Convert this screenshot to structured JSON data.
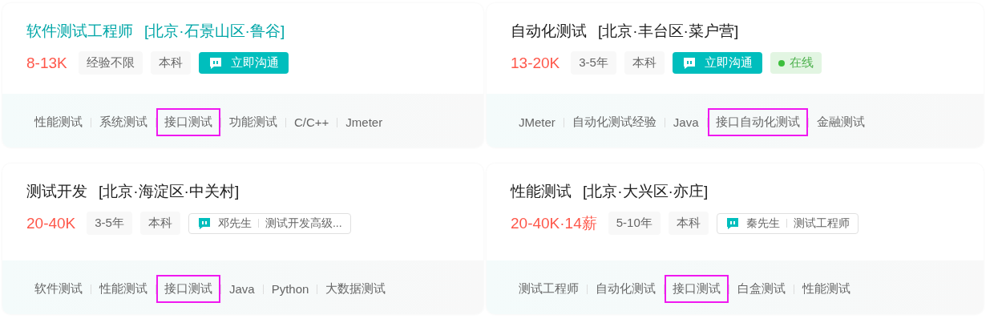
{
  "cards": [
    {
      "title": "软件测试工程师",
      "location": "[北京·石景山区·鲁谷]",
      "title_active": true,
      "salary": "8-13K",
      "tags": [
        "经验不限",
        "本科"
      ],
      "contact": {
        "kind": "chat_button",
        "label": "立即沟通"
      },
      "online": false,
      "skills": [
        {
          "label": "性能测试",
          "highlighted": false
        },
        {
          "label": "系统测试",
          "highlighted": false
        },
        {
          "label": "接口测试",
          "highlighted": true
        },
        {
          "label": "功能测试",
          "highlighted": false
        },
        {
          "label": "C/C++",
          "highlighted": false
        },
        {
          "label": "Jmeter",
          "highlighted": false
        }
      ]
    },
    {
      "title": "自动化测试",
      "location": "[北京·丰台区·菜户营]",
      "title_active": false,
      "salary": "13-20K",
      "tags": [
        "3-5年",
        "本科"
      ],
      "contact": {
        "kind": "chat_button",
        "label": "立即沟通"
      },
      "online": true,
      "online_label": "在线",
      "skills": [
        {
          "label": "JMeter",
          "highlighted": false
        },
        {
          "label": "自动化测试经验",
          "highlighted": false
        },
        {
          "label": "Java",
          "highlighted": false
        },
        {
          "label": "接口自动化测试",
          "highlighted": true
        },
        {
          "label": "金融测试",
          "highlighted": false
        }
      ]
    },
    {
      "title": "测试开发",
      "location": "[北京·海淀区·中关村]",
      "title_active": false,
      "salary": "20-40K",
      "tags": [
        "3-5年",
        "本科"
      ],
      "contact": {
        "kind": "recruiter",
        "name": "邓先生",
        "role": "测试开发高级..."
      },
      "online": false,
      "skills": [
        {
          "label": "软件测试",
          "highlighted": false
        },
        {
          "label": "性能测试",
          "highlighted": false
        },
        {
          "label": "接口测试",
          "highlighted": true
        },
        {
          "label": "Java",
          "highlighted": false
        },
        {
          "label": "Python",
          "highlighted": false
        },
        {
          "label": "大数据测试",
          "highlighted": false
        }
      ]
    },
    {
      "title": "性能测试",
      "location": "[北京·大兴区·亦庄]",
      "title_active": false,
      "salary": "20-40K·14薪",
      "tags": [
        "5-10年",
        "本科"
      ],
      "contact": {
        "kind": "recruiter",
        "name": "秦先生",
        "role": "测试工程师"
      },
      "online": false,
      "skills": [
        {
          "label": "测试工程师",
          "highlighted": false
        },
        {
          "label": "自动化测试",
          "highlighted": false
        },
        {
          "label": "接口测试",
          "highlighted": true
        },
        {
          "label": "白盒测试",
          "highlighted": false
        },
        {
          "label": "性能测试",
          "highlighted": false
        }
      ]
    }
  ]
}
